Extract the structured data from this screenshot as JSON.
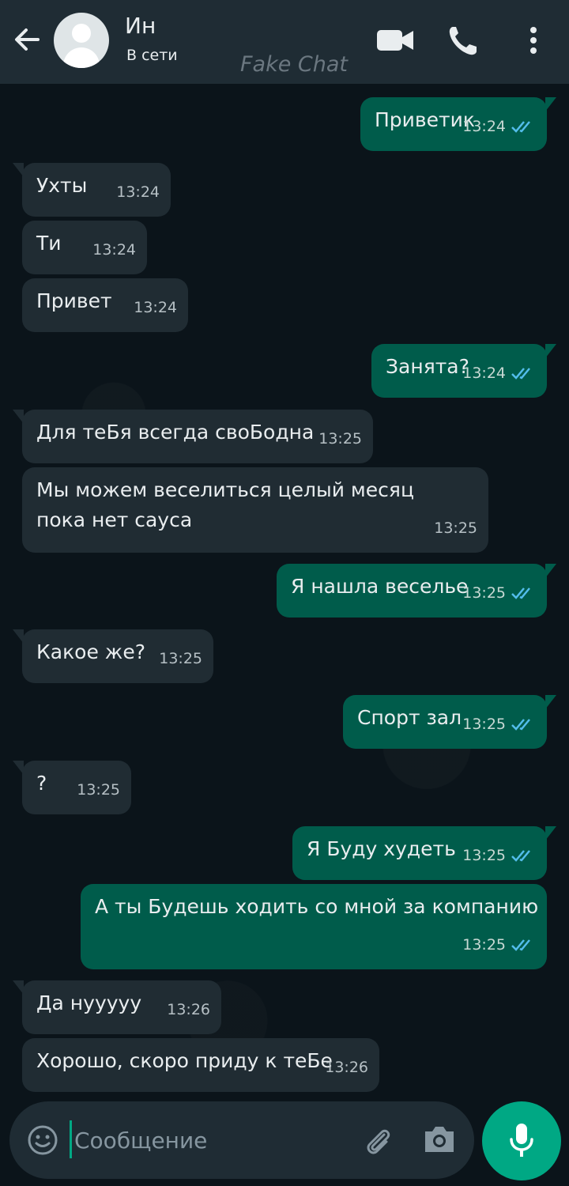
{
  "header": {
    "contact_name": "Ин",
    "status": "В сети",
    "watermark": "Fake Chat"
  },
  "messages": [
    {
      "direction": "out",
      "text": "Приветик",
      "time": "13:24",
      "read": true
    },
    {
      "direction": "in",
      "text": "Ухты",
      "time": "13:24"
    },
    {
      "direction": "in",
      "text": "Ти",
      "time": "13:24"
    },
    {
      "direction": "in",
      "text": "Привет",
      "time": "13:24"
    },
    {
      "direction": "out",
      "text": "Занята?",
      "time": "13:24",
      "read": true
    },
    {
      "direction": "in",
      "text": "Для теБя всегда своБодна",
      "time": "13:25"
    },
    {
      "direction": "in",
      "text": "Мы можем веселиться целый месяц пока нет сауса",
      "time": "13:25"
    },
    {
      "direction": "out",
      "text": "Я нашла веселье",
      "time": "13:25",
      "read": true
    },
    {
      "direction": "in",
      "text": "Какое же?",
      "time": "13:25"
    },
    {
      "direction": "out",
      "text": "Спорт зал",
      "time": "13:25",
      "read": true
    },
    {
      "direction": "in",
      "text": "?",
      "time": "13:25"
    },
    {
      "direction": "out",
      "text": "Я Буду худеть",
      "time": "13:25",
      "read": true
    },
    {
      "direction": "out",
      "text": "А ты Будешь ходить со мной за компанию",
      "time": "13:25",
      "read": true
    },
    {
      "direction": "in",
      "text": "Да нууууу",
      "time": "13:26"
    },
    {
      "direction": "in",
      "text": "Хорошо, скоро приду к теБе",
      "time": "13:26"
    }
  ],
  "composer": {
    "placeholder": "Сообщение"
  },
  "colors": {
    "header_bg": "#1f2c34",
    "incoming_bubble": "#202c33",
    "outgoing_bubble": "#005c4b",
    "accent": "#00a884",
    "read_ticks": "#53bdeb"
  }
}
